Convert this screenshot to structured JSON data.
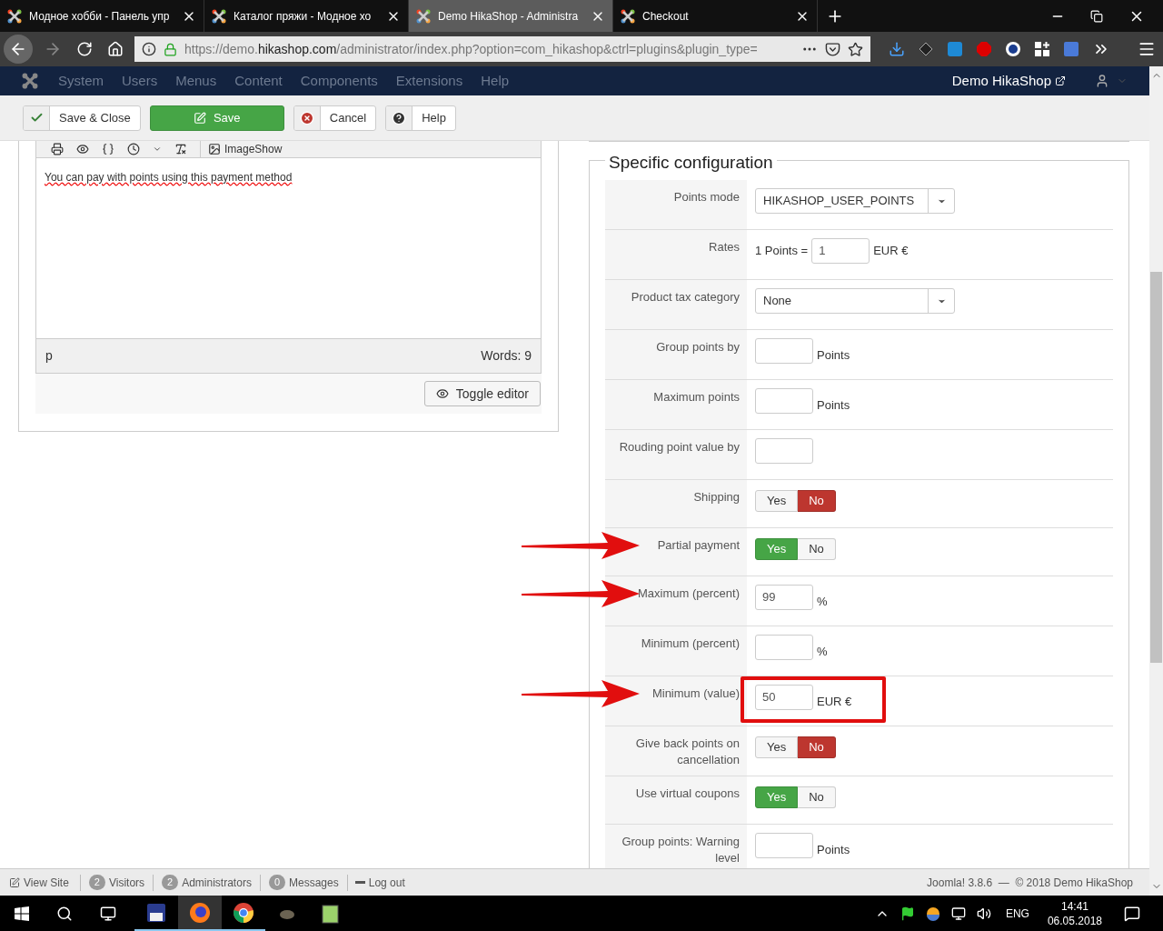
{
  "browser": {
    "tabs": [
      {
        "title": "Модное хобби - Панель упр",
        "selected": false
      },
      {
        "title": "Каталог пряжи - Модное хо",
        "selected": false
      },
      {
        "title": "Demo HikaShop - Administra",
        "selected": true
      },
      {
        "title": "Checkout",
        "selected": false
      }
    ],
    "url_prefix": "https://demo.",
    "url_domain": "hikashop.com",
    "url_rest": "/administrator/index.php?option=com_hikashop&ctrl=plugins&plugin_type="
  },
  "nav": {
    "menu": [
      "System",
      "Users",
      "Menus",
      "Content",
      "Components",
      "Extensions",
      "Help"
    ],
    "site": "Demo HikaShop"
  },
  "toolbar": [
    {
      "label": "Save & Close",
      "kind": "saveclose"
    },
    {
      "label": "Save",
      "kind": "save"
    },
    {
      "label": "Cancel",
      "kind": "cancel"
    },
    {
      "label": "Help",
      "kind": "help"
    }
  ],
  "editor": {
    "toolbar_label": "ImageShow",
    "text": "You can pay with points using this payment method",
    "path": "p",
    "words": "Words: 9",
    "toggle": "Toggle editor"
  },
  "config": {
    "legend": "Specific configuration",
    "rows": [
      {
        "label": "Points mode",
        "kind": "select",
        "value": "HIKASHOP_USER_POINTS"
      },
      {
        "label": "Rates",
        "kind": "rates",
        "prefix": "1 Points =",
        "value": "1",
        "suffix": "EUR €"
      },
      {
        "label": "Product tax category",
        "kind": "select",
        "value": "None"
      },
      {
        "label": "Group points by",
        "kind": "input",
        "suffix": "Points"
      },
      {
        "label": "Maximum points",
        "kind": "input",
        "suffix": "Points"
      },
      {
        "label": "Rouding point value by",
        "kind": "input"
      },
      {
        "label": "Shipping",
        "kind": "toggle",
        "options": [
          {
            "label": "Yes",
            "selected": false
          },
          {
            "label": "No",
            "selected": true
          }
        ]
      },
      {
        "label": "Partial payment",
        "kind": "toggle",
        "arrow": true,
        "options": [
          {
            "label": "Yes",
            "selected": true
          },
          {
            "label": "No",
            "selected": false
          }
        ]
      },
      {
        "label": "Maximum (percent)",
        "kind": "input",
        "arrow": true,
        "value": "99",
        "suffix": "%"
      },
      {
        "label": "Minimum (percent)",
        "kind": "input",
        "suffix": "%"
      },
      {
        "label": "Minimum (value)",
        "kind": "input",
        "arrow": true,
        "highlighted": true,
        "value": "50",
        "suffix": "EUR €"
      },
      {
        "label": "Give back points on cancellation",
        "kind": "toggle",
        "options": [
          {
            "label": "Yes",
            "selected": false
          },
          {
            "label": "No",
            "selected": true
          }
        ]
      },
      {
        "label": "Use virtual coupons",
        "kind": "toggle",
        "options": [
          {
            "label": "Yes",
            "selected": true
          },
          {
            "label": "No",
            "selected": false
          }
        ]
      },
      {
        "label": "Group points: Warning level",
        "kind": "input",
        "suffix": "Points"
      }
    ]
  },
  "status": {
    "view_site": "View Site",
    "items": [
      {
        "count": "2",
        "label": "Visitors"
      },
      {
        "count": "2",
        "label": "Administrators"
      },
      {
        "count": "0",
        "label": "Messages"
      }
    ],
    "logout": "Log out",
    "footer": "Joomla! 3.8.6  —  © 2018 Demo HikaShop"
  },
  "taskbar": {
    "lang": "ENG",
    "time": "14:41",
    "date": "06.05.2018"
  }
}
